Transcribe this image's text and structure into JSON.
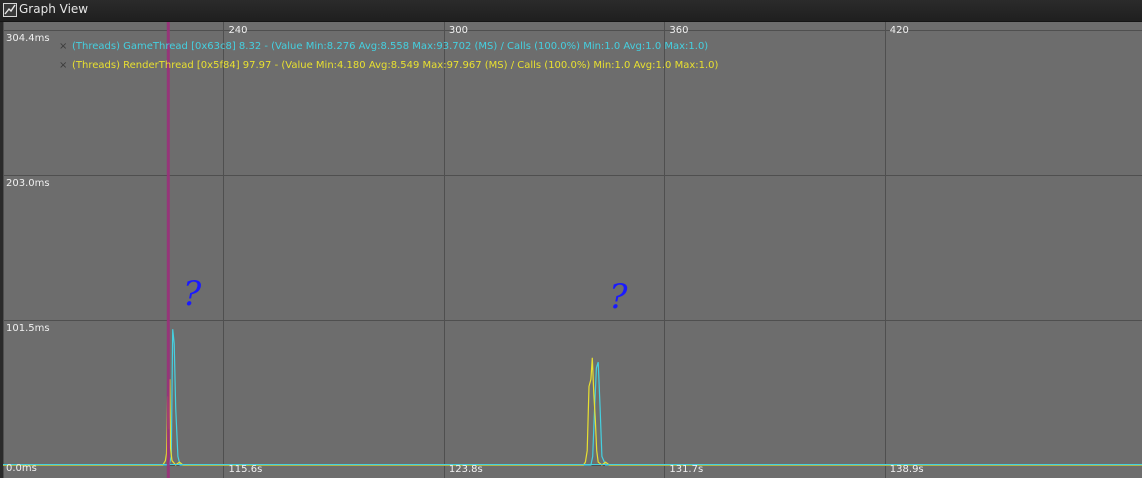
{
  "window": {
    "title": "Graph View",
    "icon": "graph-view-icon"
  },
  "colors": {
    "background": "#6d6d6d",
    "grid": "#4f4f4f",
    "game_thread": "#45d0e0",
    "render_thread": "#e8e030",
    "marker": "#9a2f7a",
    "annotation": "#1a1aff"
  },
  "legend": [
    {
      "remove_icon": "close-icon",
      "text": "(Threads) GameThread [0x63c8] 8.32 - (Value Min:8.276 Avg:8.558 Max:93.702 (MS) / Calls (100.0%) Min:1.0 Avg:1.0 Max:1.0)",
      "color": "#45d0e0"
    },
    {
      "remove_icon": "close-icon",
      "text": "(Threads) RenderThread [0x5f84] 97.97 - (Value Min:4.180 Avg:8.549 Max:97.967 (MS) / Calls (100.0%) Min:1.0 Avg:1.0 Max:1.0)",
      "color": "#e8e030"
    }
  ],
  "chart_data": {
    "type": "line",
    "title": "",
    "xlabel": "",
    "ylabel": "",
    "y_unit": "ms",
    "ylim": [
      0,
      304.4
    ],
    "y_ticks": [
      {
        "value": 304.4,
        "label": "304.4ms"
      },
      {
        "value": 203.0,
        "label": "203.0ms"
      },
      {
        "value": 101.5,
        "label": "101.5ms"
      },
      {
        "value": 0,
        "label": "0.0ms"
      }
    ],
    "xlim": [
      180,
      490
    ],
    "x_frame_ticks": [
      {
        "value": 240,
        "label": "240"
      },
      {
        "value": 300,
        "label": "300"
      },
      {
        "value": 360,
        "label": "360"
      },
      {
        "value": 420,
        "label": "420"
      }
    ],
    "x_time_labels": [
      {
        "value": 240,
        "label": "115.6s"
      },
      {
        "value": 300,
        "label": "123.8s"
      },
      {
        "value": 360,
        "label": "131.7s"
      },
      {
        "value": 420,
        "label": "138.9s"
      }
    ],
    "extra_gridlines_x": [
      180
    ],
    "marker_x": 225,
    "grid": true,
    "series": [
      {
        "name": "(Threads) GameThread [0x63c8]",
        "color": "#45d0e0",
        "points": [
          [
            180,
            0
          ],
          [
            224.5,
            0
          ],
          [
            225.2,
            0
          ],
          [
            225.8,
            6
          ],
          [
            226.2,
            95
          ],
          [
            226.6,
            85
          ],
          [
            227,
            40
          ],
          [
            227.6,
            6
          ],
          [
            228.2,
            0
          ],
          [
            339,
            0
          ],
          [
            340,
            0
          ],
          [
            340.5,
            6
          ],
          [
            341,
            38
          ],
          [
            341.5,
            68
          ],
          [
            342,
            72
          ],
          [
            342.5,
            40
          ],
          [
            343,
            6
          ],
          [
            344,
            0
          ],
          [
            490,
            0
          ]
        ]
      },
      {
        "name": "(Threads) RenderThread [0x5f84]",
        "color": "#e8e030",
        "points": [
          [
            180,
            0
          ],
          [
            223.5,
            0
          ],
          [
            224.2,
            3
          ],
          [
            224.5,
            8
          ],
          [
            224.8,
            48
          ],
          [
            225.1,
            25
          ],
          [
            225.4,
            60
          ],
          [
            225.6,
            12
          ],
          [
            226,
            3
          ],
          [
            227,
            0
          ],
          [
            228,
            2
          ],
          [
            229,
            0
          ],
          [
            338,
            0
          ],
          [
            338.5,
            2
          ],
          [
            339,
            10
          ],
          [
            339.5,
            55
          ],
          [
            340,
            60
          ],
          [
            340.4,
            75
          ],
          [
            340.8,
            50
          ],
          [
            341.2,
            32
          ],
          [
            341.6,
            10
          ],
          [
            342,
            2
          ],
          [
            343,
            0
          ],
          [
            344,
            2
          ],
          [
            345,
            0
          ],
          [
            490,
            0
          ]
        ]
      }
    ],
    "annotations": [
      {
        "text": "?",
        "x": 229,
        "y": 112
      },
      {
        "text": "?",
        "x": 345,
        "y": 110
      }
    ]
  }
}
